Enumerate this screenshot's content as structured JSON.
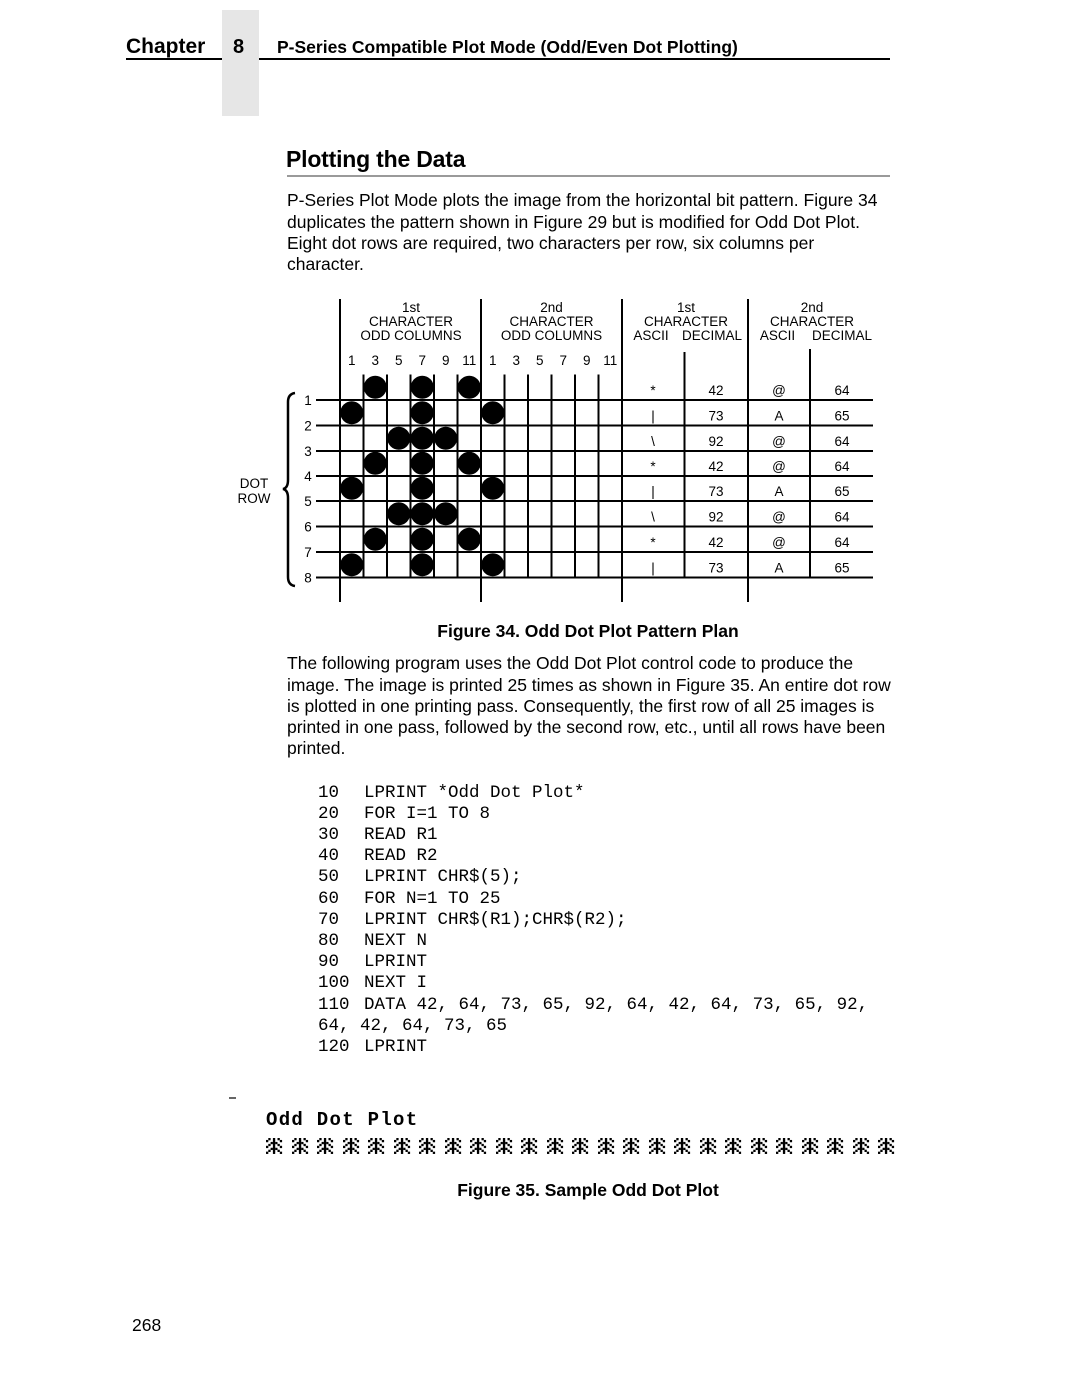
{
  "header": {
    "chapter_label": "Chapter",
    "chapter_number": "8",
    "chapter_title": "P-Series Compatible Plot Mode (Odd/Even Dot Plotting)"
  },
  "section": {
    "title": "Plotting the Data"
  },
  "paragraphs": [
    {
      "lines": [
        "P-Series Plot Mode plots the image from the horizontal bit pattern. Figure 34",
        "duplicates the pattern shown in Figure 29 but is modified for Odd Dot Plot.",
        "Eight dot rows are required, two characters per row, six columns per",
        "character."
      ]
    },
    {
      "lines": [
        "The following program uses the Odd Dot Plot control code to produce the",
        "image. The image is printed 25 times as shown in Figure 35. An entire dot row",
        "is plotted in one printing pass. Consequently, the first row of all 25 images is",
        "printed in one pass, followed by the second row, etc., until all rows have been",
        "printed."
      ]
    }
  ],
  "figure34": {
    "caption": "Figure 34. Odd Dot Plot Pattern Plan",
    "dot_row_label": [
      "DOT",
      "ROW"
    ],
    "row_numbers": [
      "1",
      "2",
      "3",
      "4",
      "5",
      "6",
      "7",
      "8"
    ],
    "column_numbers": [
      "1",
      "3",
      "5",
      "7",
      "9",
      "11"
    ],
    "headers": {
      "char1": [
        "1st",
        "CHARACTER",
        "ODD COLUMNS"
      ],
      "char2": [
        "2nd",
        "CHARACTER",
        "ODD COLUMNS"
      ],
      "ascii1": [
        "1st",
        "CHARACTER",
        "ASCII",
        "DECIMAL"
      ],
      "ascii2": [
        "2nd",
        "CHARACTER",
        "ASCII",
        "DECIMAL"
      ]
    },
    "rows": [
      {
        "dots_char1": [
          3,
          7,
          11
        ],
        "dots_char2": [],
        "ascii1": "*",
        "decimal1": "42",
        "ascii2": "@",
        "decimal2": "64"
      },
      {
        "dots_char1": [
          1,
          7
        ],
        "dots_char2": [
          1
        ],
        "ascii1": "|",
        "decimal1": "73",
        "ascii2": "A",
        "decimal2": "65"
      },
      {
        "dots_char1": [
          5,
          7,
          9
        ],
        "dots_char2": [],
        "ascii1": "\\",
        "decimal1": "92",
        "ascii2": "@",
        "decimal2": "64"
      },
      {
        "dots_char1": [
          3,
          7,
          11
        ],
        "dots_char2": [],
        "ascii1": "*",
        "decimal1": "42",
        "ascii2": "@",
        "decimal2": "64"
      },
      {
        "dots_char1": [
          1,
          7
        ],
        "dots_char2": [
          1
        ],
        "ascii1": "|",
        "decimal1": "73",
        "ascii2": "A",
        "decimal2": "65"
      },
      {
        "dots_char1": [
          5,
          7,
          9
        ],
        "dots_char2": [],
        "ascii1": "\\",
        "decimal1": "92",
        "ascii2": "@",
        "decimal2": "64"
      },
      {
        "dots_char1": [
          3,
          7,
          11
        ],
        "dots_char2": [],
        "ascii1": "*",
        "decimal1": "42",
        "ascii2": "@",
        "decimal2": "64"
      },
      {
        "dots_char1": [
          1,
          7
        ],
        "dots_char2": [
          1
        ],
        "ascii1": "|",
        "decimal1": "73",
        "ascii2": "A",
        "decimal2": "65"
      }
    ]
  },
  "program": {
    "lines": [
      {
        "number": "10",
        "code": "LPRINT *Odd Dot Plot*"
      },
      {
        "number": "20",
        "code": "FOR I=1 TO 8"
      },
      {
        "number": "30",
        "code": "READ R1"
      },
      {
        "number": "40",
        "code": "READ R2"
      },
      {
        "number": "50",
        "code": "LPRINT CHR$(5);"
      },
      {
        "number": "60",
        "code": "FOR N=1 TO 25"
      },
      {
        "number": "70",
        "code": "LPRINT CHR$(R1);CHR$(R2);"
      },
      {
        "number": "80",
        "code": "NEXT N"
      },
      {
        "number": "90",
        "code": "LPRINT"
      },
      {
        "number": "100",
        "code": "NEXT I"
      },
      {
        "number": "110",
        "code": "DATA 42, 64, 73, 65, 92, 64, 42, 64, 73, 65, 92,"
      },
      {
        "number": "",
        "code": "64, 42, 64, 73, 65"
      },
      {
        "number": "120",
        "code": "LPRINT"
      }
    ]
  },
  "figure35": {
    "printed_title": "Odd Dot Plot",
    "repeat_count": 25,
    "caption": "Figure 35. Sample Odd Dot Plot"
  },
  "page_number": "268"
}
